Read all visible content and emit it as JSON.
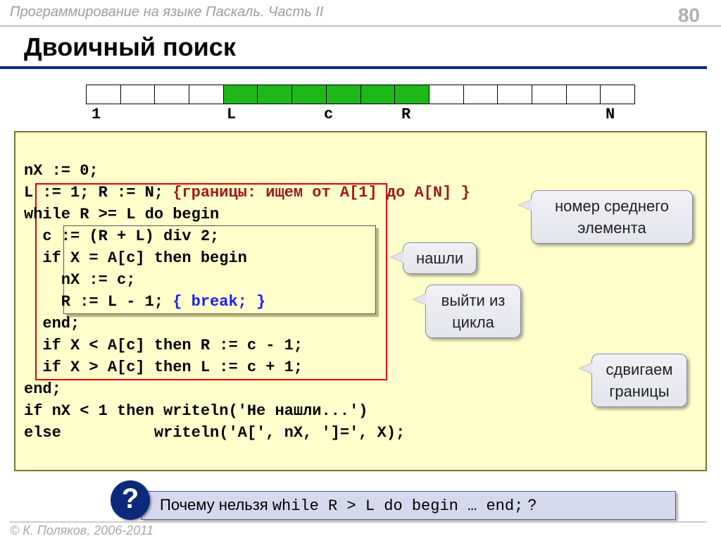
{
  "header": {
    "course": "Программирование на языке Паскаль. Часть II",
    "page": "80"
  },
  "title": "Двоичный поиск",
  "array": {
    "cells": [
      "",
      "",
      "",
      "",
      "g",
      "g",
      "g",
      "g",
      "g",
      "g",
      "",
      "",
      "",
      "",
      "",
      ""
    ],
    "labels": {
      "one": "1",
      "L": "L",
      "c": "c",
      "R": "R",
      "N": "N"
    }
  },
  "code": {
    "l1": "nX := 0;",
    "l2a": "L := 1; R := N; ",
    "l2b": "{границы: ищем от A[1] до A[N] }",
    "l3": "while R >= L do begin",
    "l4": "  c := (R + L) div 2;",
    "l5": "  if X = A[c] then begin",
    "l6": "    nX := c;",
    "l7a": "    R := L - 1; ",
    "l7b": "{ break; }",
    "l8": "  end;",
    "l9": "  if X < A[c] then R := c - 1;",
    "l10": "  if X > A[c] then L := c + 1;",
    "l11": "end;",
    "l12": "if nX < 1 then writeln('Не нашли...')",
    "l13": "else          writeln('A[', nX, ']=', X);"
  },
  "callouts": {
    "mid": "номер среднего элемента",
    "found": "нашли",
    "exit": "выйти из цикла",
    "shift": "сдвигаем границы"
  },
  "question": {
    "pre": "Почему нельзя ",
    "code": "while R > L do begin … end;",
    "post": " ?",
    "mark": "?"
  },
  "footer": "© К. Поляков, 2006-2011"
}
